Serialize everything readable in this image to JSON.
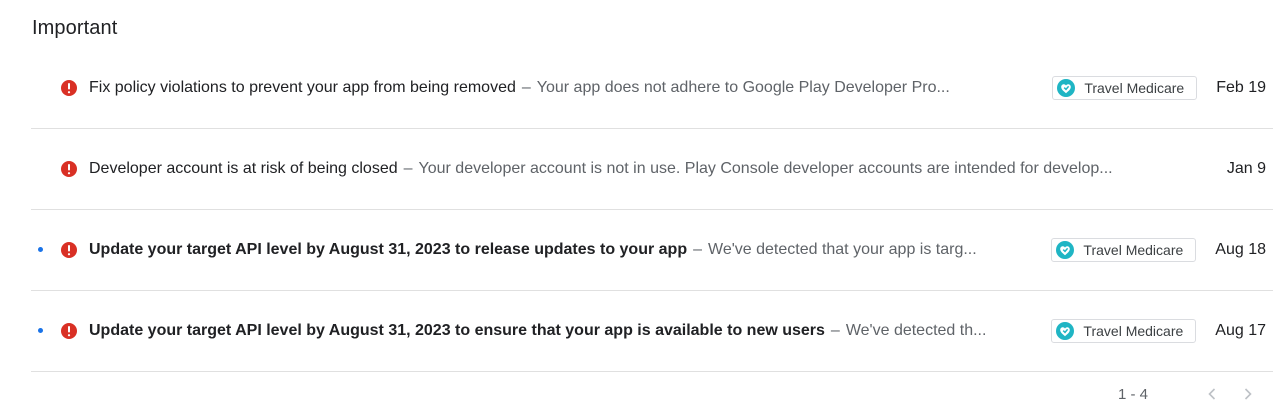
{
  "section": {
    "title": "Important"
  },
  "colors": {
    "accent": "#1a73e8",
    "error": "#d93025",
    "app_teal": "#1fb5c4"
  },
  "rows": [
    {
      "unread": false,
      "subject": "Fix policy violations to prevent your app from being removed",
      "separator": "–",
      "snippet": "Your app does not adhere to Google Play Developer Pro...",
      "app": "Travel Medicare",
      "date": "Feb 19"
    },
    {
      "unread": false,
      "subject": "Developer account is at risk of being closed",
      "separator": "–",
      "snippet": "Your developer account is not in use. Play Console developer accounts are intended for develop...",
      "app": null,
      "date": "Jan 9"
    },
    {
      "unread": true,
      "subject": "Update your target API level by August 31, 2023 to release updates to your app",
      "separator": "–",
      "snippet": "We've detected that your app is targ...",
      "app": "Travel Medicare",
      "date": "Aug 18"
    },
    {
      "unread": true,
      "subject": "Update your target API level by August 31, 2023 to ensure that your app is available to new users",
      "separator": "–",
      "snippet": "We've detected th...",
      "app": "Travel Medicare",
      "date": "Aug 17"
    }
  ],
  "pager": {
    "range": "1 - 4",
    "prev_icon": "chevron-left-icon",
    "next_icon": "chevron-right-icon"
  }
}
